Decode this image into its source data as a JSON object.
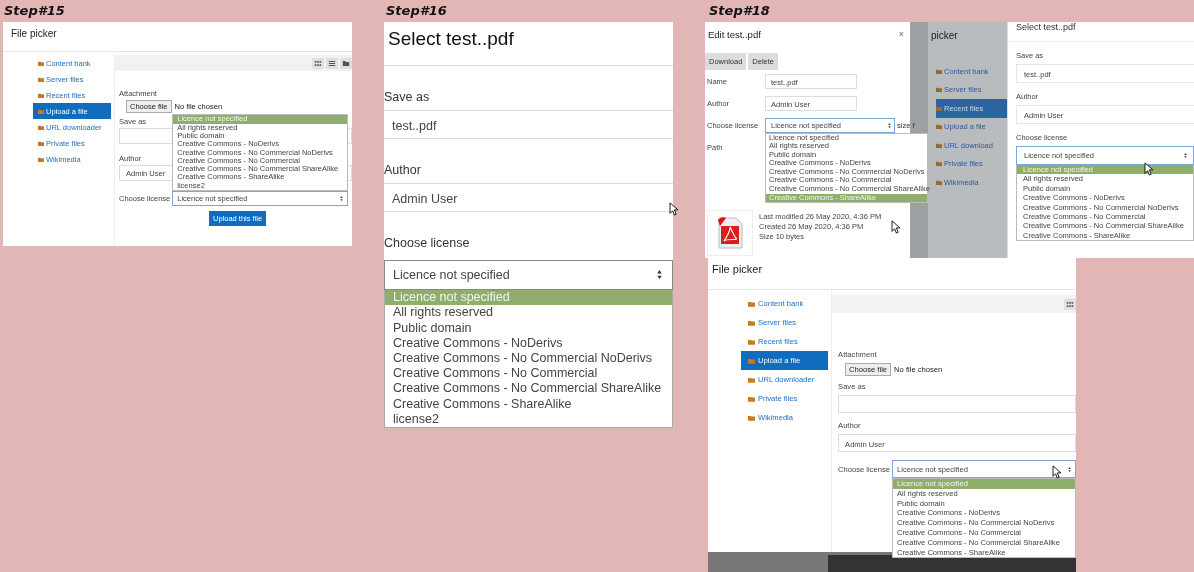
{
  "step15": {
    "step_label": "Step#15",
    "title": "File picker",
    "sources": [
      {
        "label": "Content bank",
        "selected": false
      },
      {
        "label": "Server files",
        "selected": false
      },
      {
        "label": "Recent files",
        "selected": false
      },
      {
        "label": "Upload a file",
        "selected": true
      },
      {
        "label": "URL downloader",
        "selected": false
      },
      {
        "label": "Private files",
        "selected": false
      },
      {
        "label": "Wikimedia",
        "selected": false
      }
    ],
    "attachment_label": "Attachment",
    "choose_file": "Choose file",
    "file_status": "No file chosen",
    "save_as_label": "Save as",
    "author_label": "Author",
    "author": "Admin User",
    "license_label": "Choose license",
    "license": "Licence not specified",
    "license_options": [
      {
        "label": "Licence not specified",
        "selected": true
      },
      {
        "label": "All rights reserved",
        "selected": false
      },
      {
        "label": "Public domain",
        "selected": false
      },
      {
        "label": "Creative Commons - NoDerivs",
        "selected": false
      },
      {
        "label": "Creative Commons - No Commercial NoDerivs",
        "selected": false
      },
      {
        "label": "Creative Commons - No Commercial",
        "selected": false
      },
      {
        "label": "Creative Commons - No Commercial ShareAlike",
        "selected": false
      },
      {
        "label": "Creative Commons - ShareAlike",
        "selected": false
      },
      {
        "label": "license2",
        "selected": false
      }
    ],
    "upload_button": "Upload this file"
  },
  "step16": {
    "step_label": "Step#16",
    "title": "Select test..pdf",
    "save_as_label": "Save as",
    "save_as": "test..pdf",
    "author_label": "Author",
    "author": "Admin User",
    "license_label": "Choose license",
    "license": "Licence not specified",
    "license_options": [
      {
        "label": "Licence not specified",
        "selected": true
      },
      {
        "label": "All rights reserved",
        "selected": false
      },
      {
        "label": "Public domain",
        "selected": false
      },
      {
        "label": "Creative Commons - NoDerivs",
        "selected": false
      },
      {
        "label": "Creative Commons - No Commercial NoDerivs",
        "selected": false
      },
      {
        "label": "Creative Commons - No Commercial",
        "selected": false
      },
      {
        "label": "Creative Commons - No Commercial ShareAlike",
        "selected": false
      },
      {
        "label": "Creative Commons - ShareAlike",
        "selected": false
      },
      {
        "label": "license2",
        "selected": false
      }
    ]
  },
  "step18": {
    "step_label": "Step#18",
    "edit_dialog": {
      "title": "Edit test..pdf",
      "close": "×",
      "buttons": [
        "Download",
        "Delete"
      ],
      "name_label": "Name",
      "name": "test..pdf",
      "author_label": "Author",
      "author": "Admin User",
      "license_label": "Choose license",
      "license": "Licence not specified",
      "cut_text": "size f",
      "path_label": "Path",
      "license_options": [
        {
          "label": "Licence not specified",
          "selected": false
        },
        {
          "label": "All rights reserved",
          "selected": false
        },
        {
          "label": "Public domain",
          "selected": false
        },
        {
          "label": "Creative Commons - NoDerivs",
          "selected": false
        },
        {
          "label": "Creative Commons - No Commercial NoDerivs",
          "selected": false
        },
        {
          "label": "Creative Commons - No Commercial",
          "selected": false
        },
        {
          "label": "Creative Commons - No Commercial ShareAlike",
          "selected": false
        },
        {
          "label": "Creative Commons - ShareAlike",
          "selected": true
        }
      ],
      "info": [
        "Last modified  26 May 2020, 4:36 PM",
        "Created  26 May 2020, 4:36 PM",
        "Size  10 bytes"
      ]
    },
    "select_panel": {
      "sidebar_title": "picker",
      "sources": [
        {
          "label": "Content bank",
          "selected": false
        },
        {
          "label": "Server files",
          "selected": false
        },
        {
          "label": "Recent files",
          "selected": true
        },
        {
          "label": "Upload a file",
          "selected": false
        },
        {
          "label": "URL download",
          "selected": false
        },
        {
          "label": "Private files",
          "selected": false
        },
        {
          "label": "Wikimedia",
          "selected": false
        }
      ],
      "title": "Select test..pdf",
      "save_as_label": "Save as",
      "save_as": "test..pdf",
      "author_label": "Author",
      "author": "Admin User",
      "license_label": "Choose license",
      "license": "Licence not specified",
      "license_options": [
        {
          "label": "Licence not specified",
          "selected": true
        },
        {
          "label": "All rights reserved",
          "selected": false
        },
        {
          "label": "Public domain",
          "selected": false
        },
        {
          "label": "Creative Commons - NoDerivs",
          "selected": false
        },
        {
          "label": "Creative Commons - No Commercial NoDerivs",
          "selected": false
        },
        {
          "label": "Creative Commons - No Commercial",
          "selected": false
        },
        {
          "label": "Creative Commons - No Commercial ShareAlike",
          "selected": false
        },
        {
          "label": "Creative Commons - ShareAlike",
          "selected": false
        }
      ]
    },
    "file_picker": {
      "title": "File picker",
      "sources": [
        {
          "label": "Content bank",
          "selected": false
        },
        {
          "label": "Server files",
          "selected": false
        },
        {
          "label": "Recent files",
          "selected": false
        },
        {
          "label": "Upload a file",
          "selected": true
        },
        {
          "label": "URL downloader",
          "selected": false
        },
        {
          "label": "Private files",
          "selected": false
        },
        {
          "label": "Wikimedia",
          "selected": false
        }
      ],
      "attachment_label": "Attachment",
      "choose_file": "Choose file",
      "file_status": "No file chosen",
      "save_as_label": "Save as",
      "author_label": "Author",
      "author": "Admin User",
      "license_label": "Choose license",
      "license": "Licence not specified",
      "license_options": [
        {
          "label": "Licence not specified",
          "selected": true
        },
        {
          "label": "All rights reserved",
          "selected": false
        },
        {
          "label": "Public domain",
          "selected": false
        },
        {
          "label": "Creative Commons - NoDerivs",
          "selected": false
        },
        {
          "label": "Creative Commons - No Commercial NoDerivs",
          "selected": false
        },
        {
          "label": "Creative Commons - No Commercial",
          "selected": false
        },
        {
          "label": "Creative Commons - No Commercial ShareAlike",
          "selected": false
        },
        {
          "label": "Creative Commons - ShareAlike",
          "selected": false
        }
      ]
    }
  }
}
